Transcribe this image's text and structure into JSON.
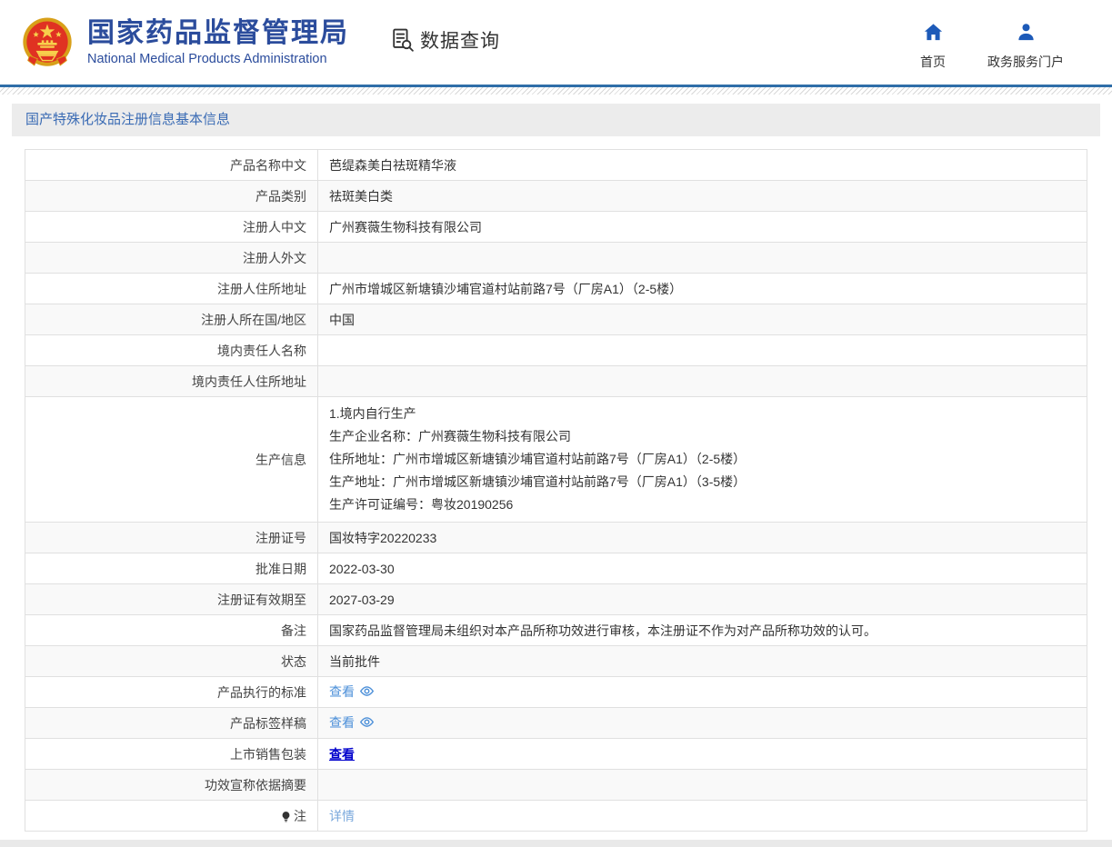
{
  "header": {
    "org_name_zh": "国家药品监督管理局",
    "org_name_en": "National Medical Products Administration",
    "data_query_label": "数据查询",
    "nav": [
      {
        "label": "首页",
        "icon": "home-icon"
      },
      {
        "label": "政务服务门户",
        "icon": "user-icon"
      }
    ]
  },
  "page": {
    "section_title": "国产特殊化妆品注册信息基本信息"
  },
  "table": {
    "rows": [
      {
        "label": "产品名称中文",
        "type": "text",
        "value": "芭缇森美白祛斑精华液"
      },
      {
        "label": "产品类别",
        "type": "text",
        "value": "祛斑美白类"
      },
      {
        "label": "注册人中文",
        "type": "text",
        "value": "广州赛薇生物科技有限公司"
      },
      {
        "label": "注册人外文",
        "type": "text",
        "value": ""
      },
      {
        "label": "注册人住所地址",
        "type": "text",
        "value": "广州市增城区新塘镇沙埔官道村站前路7号（厂房A1）（2-5楼）"
      },
      {
        "label": "注册人所在国/地区",
        "type": "text",
        "value": "中国"
      },
      {
        "label": "境内责任人名称",
        "type": "text",
        "value": ""
      },
      {
        "label": "境内责任人住所地址",
        "type": "text",
        "value": ""
      },
      {
        "label": "生产信息",
        "type": "multiline",
        "lines": [
          "1.境内自行生产",
          "生产企业名称：广州赛薇生物科技有限公司",
          "住所地址：广州市增城区新塘镇沙埔官道村站前路7号（厂房A1）（2-5楼）",
          "生产地址：广州市增城区新塘镇沙埔官道村站前路7号（厂房A1）（3-5楼）",
          "生产许可证编号：粤妆20190256"
        ]
      },
      {
        "label": "注册证号",
        "type": "text",
        "value": "国妆特字20220233"
      },
      {
        "label": "批准日期",
        "type": "text",
        "value": "2022-03-30"
      },
      {
        "label": "注册证有效期至",
        "type": "text",
        "value": "2027-03-29"
      },
      {
        "label": "备注",
        "type": "text",
        "value": "国家药品监督管理局未组织对本产品所称功效进行审核，本注册证不作为对产品所称功效的认可。"
      },
      {
        "label": "状态",
        "type": "text",
        "value": "当前批件"
      },
      {
        "label": "产品执行的标准",
        "type": "link-eye",
        "value": "查看"
      },
      {
        "label": "产品标签样稿",
        "type": "link-eye",
        "value": "查看"
      },
      {
        "label": "上市销售包装",
        "type": "link-visited",
        "value": "查看"
      },
      {
        "label": "功效宣称依据摘要",
        "type": "text",
        "value": ""
      },
      {
        "label": "注",
        "label_icon": "bulb-icon",
        "type": "link-light",
        "value": "详情"
      }
    ]
  },
  "colors": {
    "brand_blue": "#2b4c9c",
    "nav_icon_blue": "#1d5ab8",
    "divider_blue": "#2f6ea8",
    "section_title_blue": "#3a6bb4",
    "section_bg": "#ececec",
    "zebra_bg": "#f9f9f9",
    "link_blue": "#4d90d9",
    "visited_link": "#0000cc",
    "light_link": "#7aa8dc",
    "footer_gray": "#e9e9e9"
  }
}
